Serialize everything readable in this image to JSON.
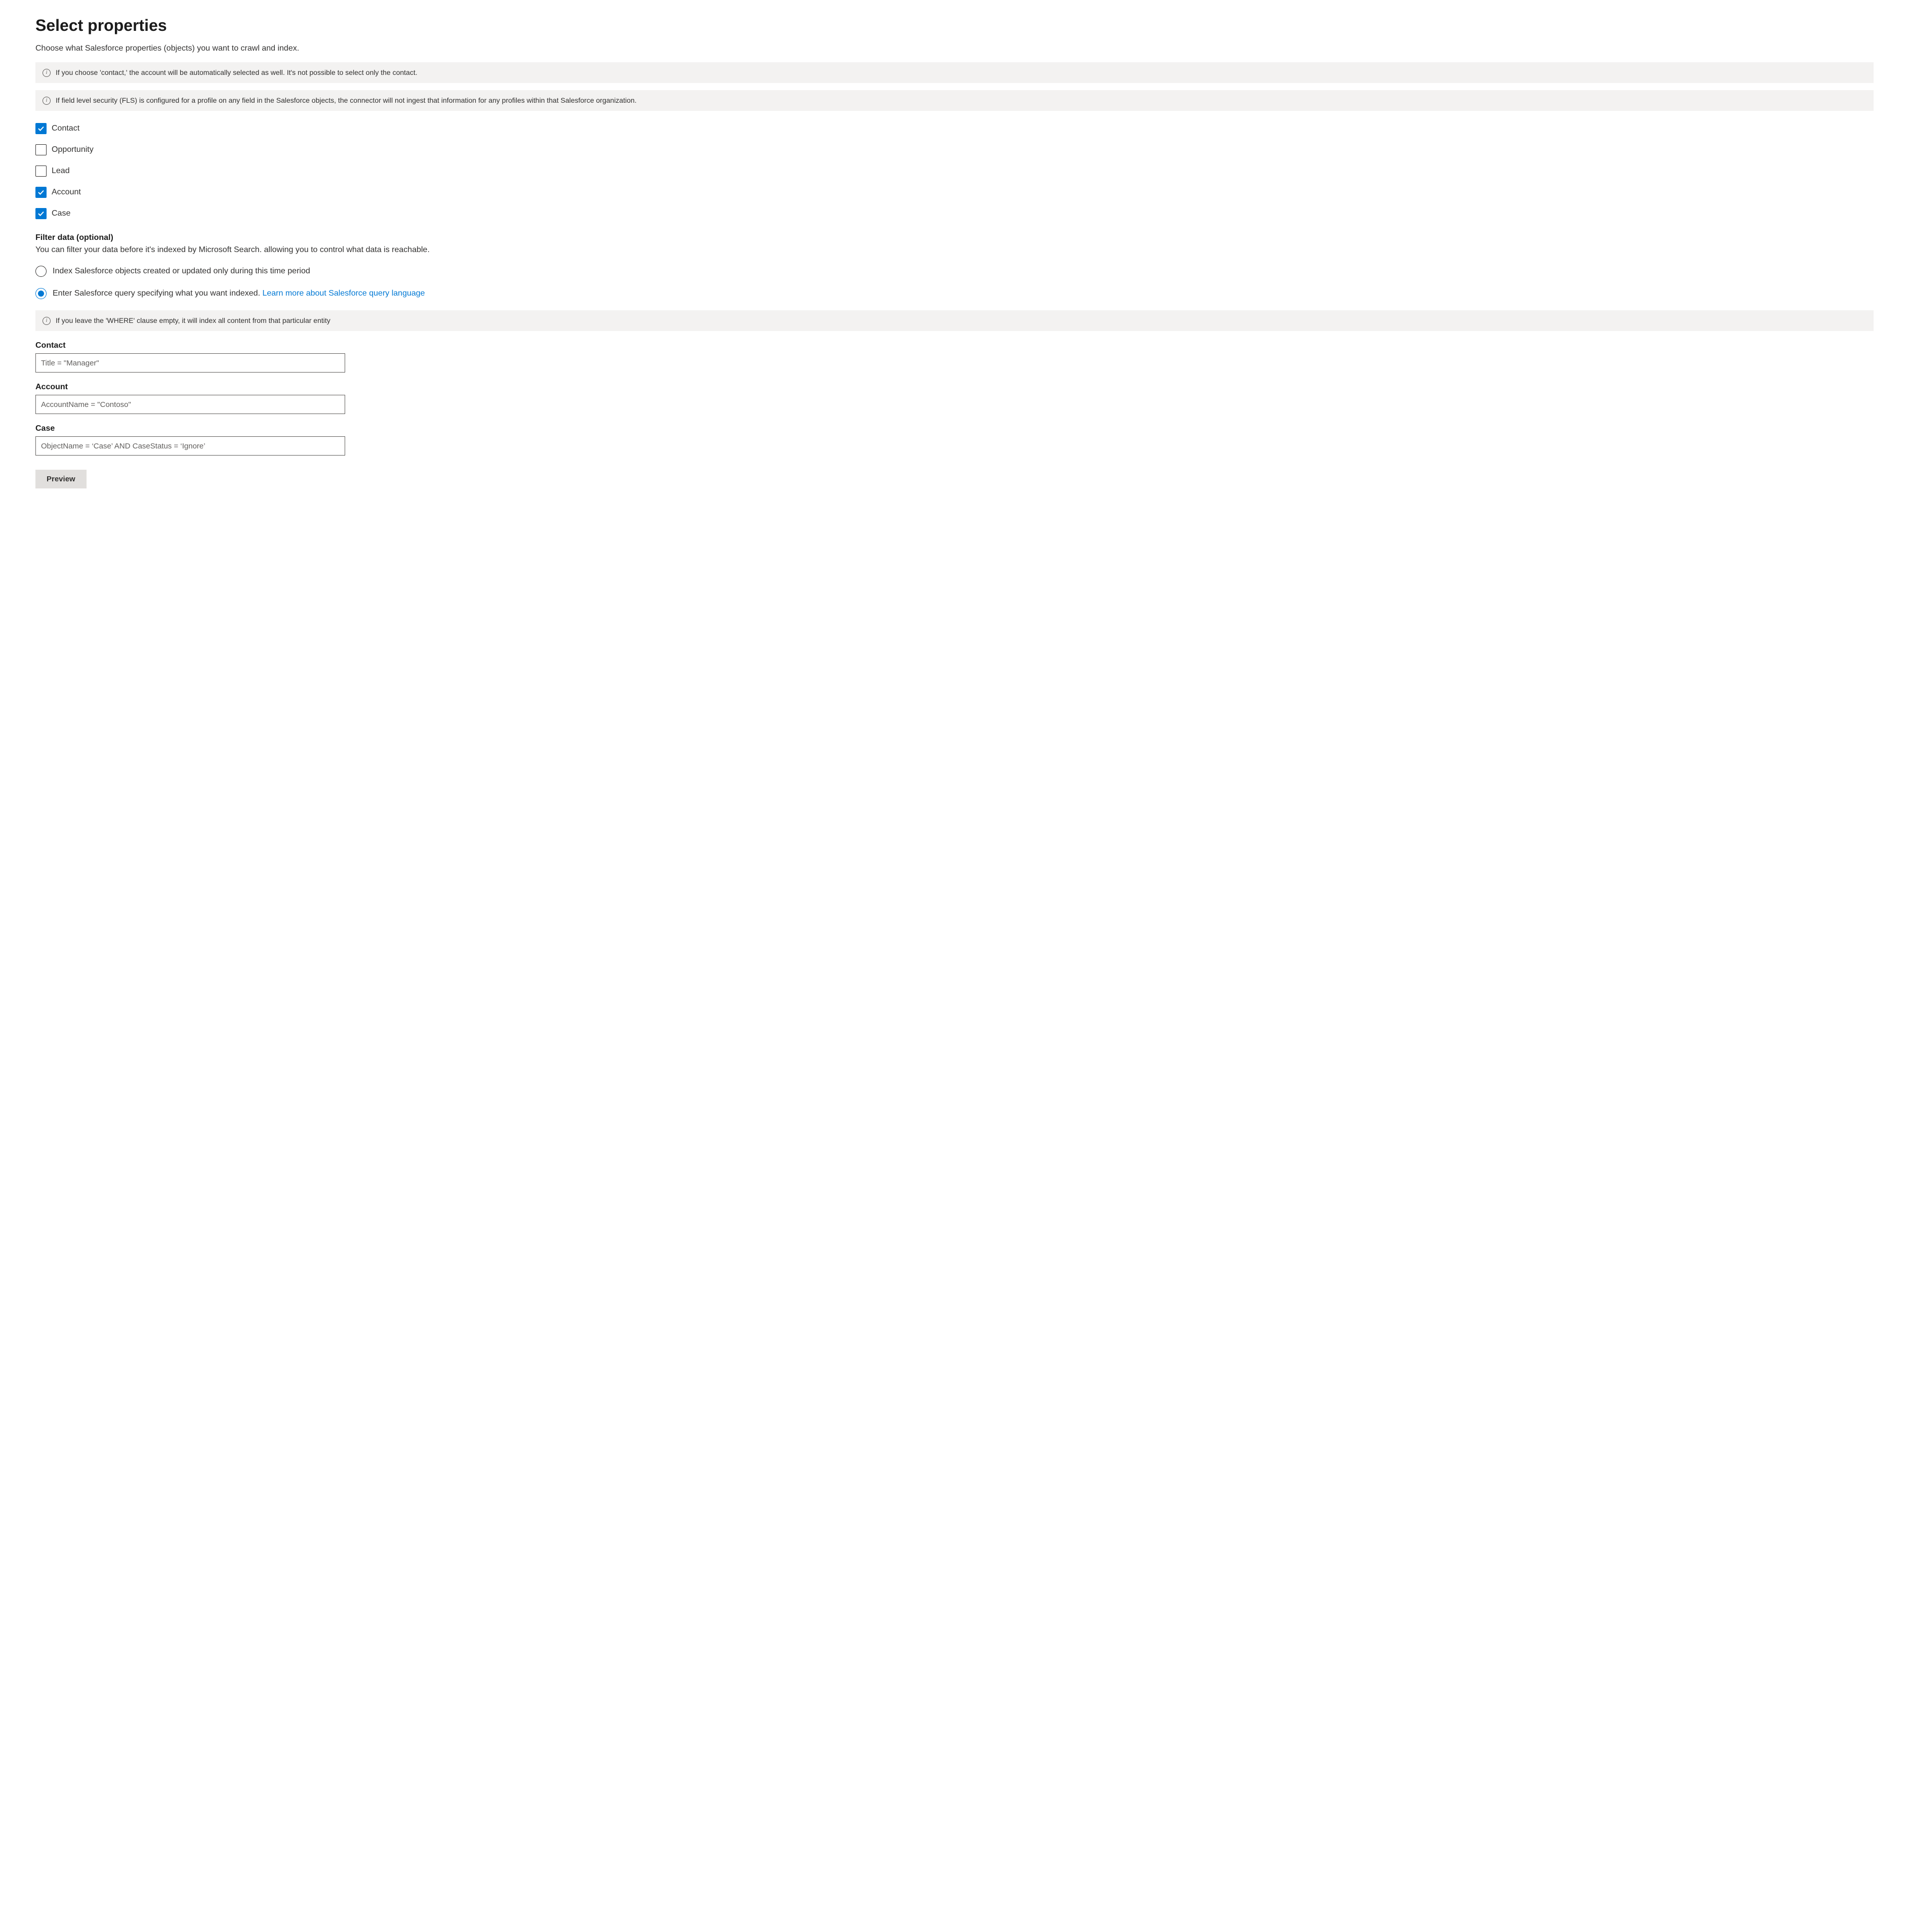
{
  "header": {
    "title": "Select properties",
    "subtitle": "Choose what Salesforce properties (objects) you want to crawl and index."
  },
  "infoBars": {
    "contactNote": "If you choose 'contact,' the account will be automatically selected as well. It's not possible to select only the contact.",
    "flsNote": "If field level security (FLS) is configured for a profile on any field in the Salesforce objects, the connector will not ingest that information for any profiles within that Salesforce organization.",
    "whereNote": "If you leave the 'WHERE' clause empty, it will index all content from that particular entity"
  },
  "checkboxes": [
    {
      "label": "Contact",
      "checked": true
    },
    {
      "label": "Opportunity",
      "checked": false
    },
    {
      "label": "Lead",
      "checked": false
    },
    {
      "label": "Account",
      "checked": true
    },
    {
      "label": "Case",
      "checked": true
    }
  ],
  "filterSection": {
    "heading": "Filter data (optional)",
    "desc": "You can filter your data before it's indexed by Microsoft Search. allowing you to control what data is reachable."
  },
  "radios": {
    "timePeriod": {
      "label": "Index Salesforce objects created or updated only during this time period",
      "selected": false
    },
    "query": {
      "label": "Enter Salesforce query specifying what you want indexed.",
      "link": "Learn more about Salesforce query language",
      "selected": true
    }
  },
  "queryFields": {
    "contact": {
      "label": "Contact",
      "placeholder": "Title = \"Manager\"",
      "value": ""
    },
    "account": {
      "label": "Account",
      "placeholder": "AccountName = \"Contoso\"",
      "value": ""
    },
    "case": {
      "label": "Case",
      "placeholder": "ObjectName = ‘Case’ AND CaseStatus = ‘Ignore’",
      "value": ""
    }
  },
  "buttons": {
    "preview": "Preview"
  }
}
